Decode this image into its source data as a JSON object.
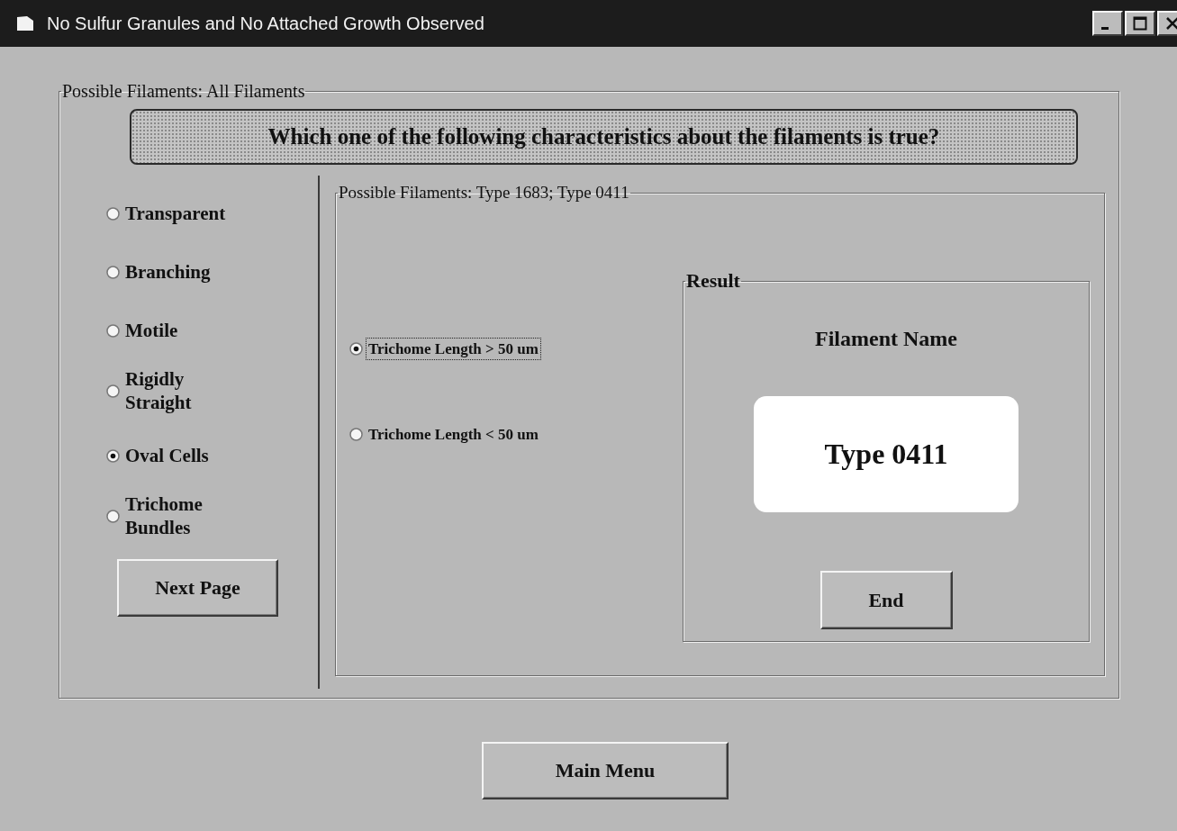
{
  "window": {
    "title": "No Sulfur Granules and No Attached Growth Observed"
  },
  "main_group": {
    "label": "Possible Filaments: All Filaments",
    "question": "Which one of the following characteristics about the filaments is true?",
    "characteristics": [
      {
        "label": "Transparent",
        "selected": false
      },
      {
        "label": "Branching",
        "selected": false
      },
      {
        "label": "Motile",
        "selected": false
      },
      {
        "label": "Rigidly Straight",
        "selected": false
      },
      {
        "label": "Oval Cells",
        "selected": true
      },
      {
        "label": "Trichome Bundles",
        "selected": false
      }
    ],
    "next_button": "Next Page",
    "sub_group": {
      "label": "Possible Filaments: Type 1683; Type 0411",
      "options": [
        {
          "label": "Trichome Length > 50 um",
          "selected": true,
          "focused": true
        },
        {
          "label": "Trichome Length < 50 um",
          "selected": false,
          "focused": false
        }
      ],
      "result": {
        "label": "Result",
        "heading": "Filament Name",
        "value": "Type 0411",
        "end_button": "End"
      }
    }
  },
  "main_menu_button": "Main Menu"
}
